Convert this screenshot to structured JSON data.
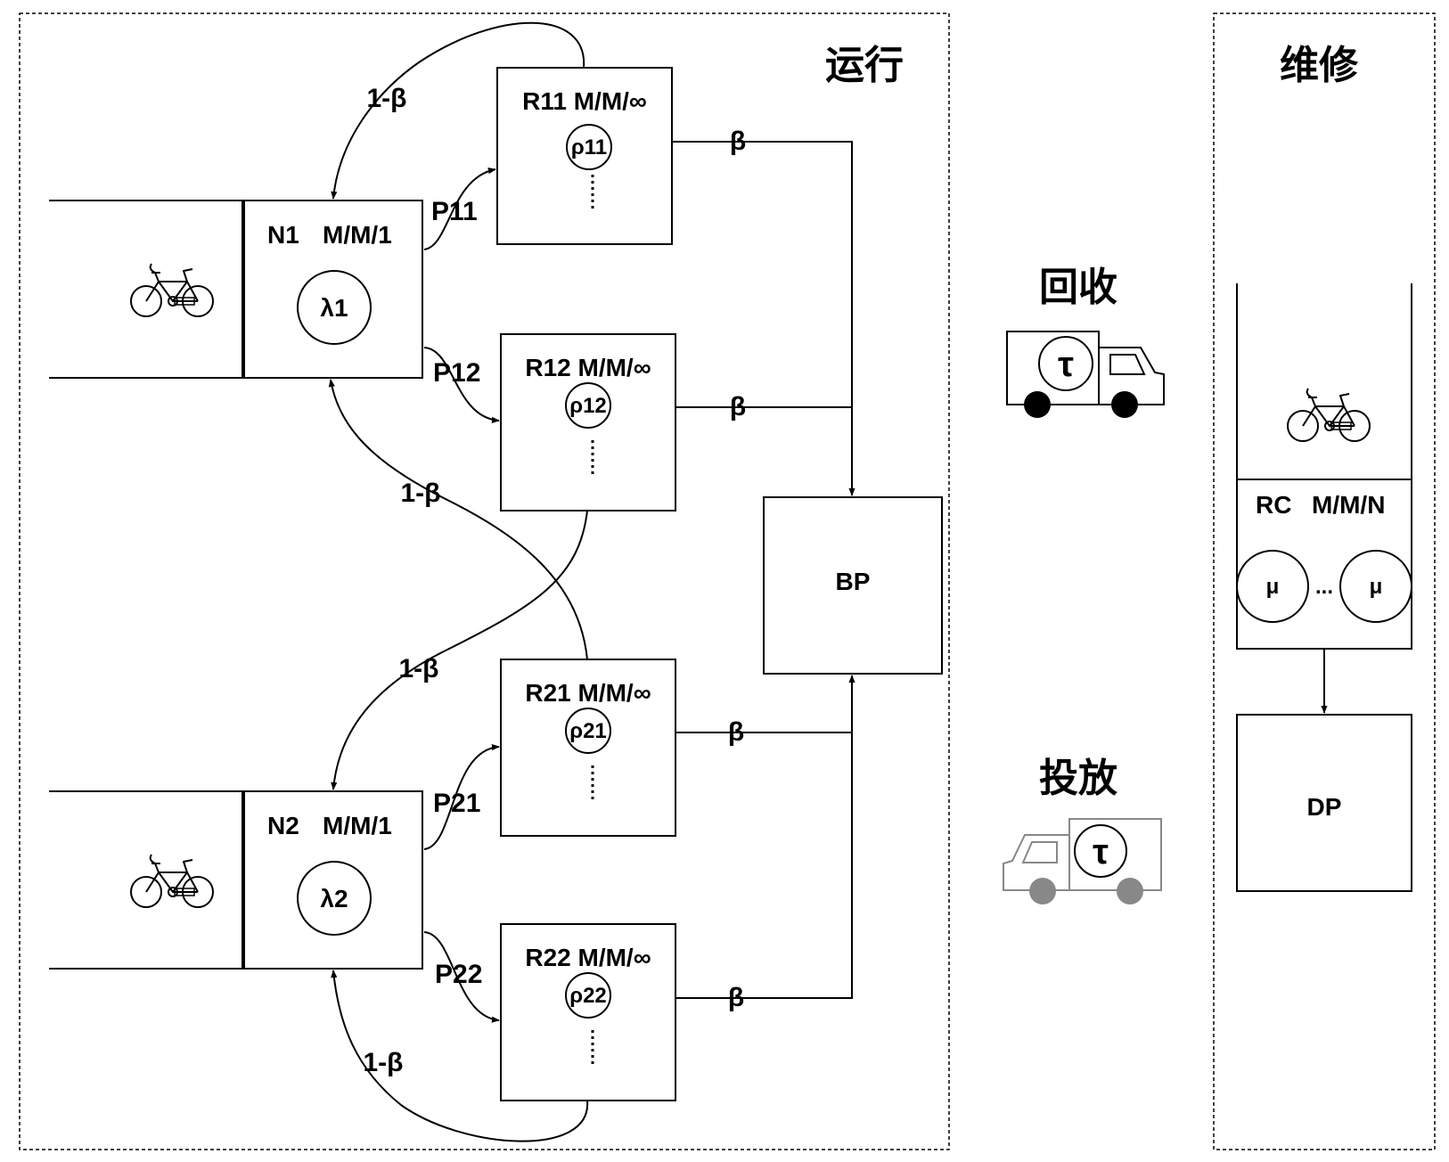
{
  "sections": {
    "operation": "运行",
    "maintenance": "维修",
    "recycle": "回收",
    "deploy": "投放"
  },
  "n1": {
    "label": "N1",
    "model": "M/M/1",
    "rate": "λ1"
  },
  "n2": {
    "label": "N2",
    "model": "M/M/1",
    "rate": "λ2"
  },
  "r11": {
    "label": "R11 M/M/∞",
    "rate": "ρ11"
  },
  "r12": {
    "label": "R12 M/M/∞",
    "rate": "ρ12"
  },
  "r21": {
    "label": "R21 M/M/∞",
    "rate": "ρ21"
  },
  "r22": {
    "label": "R22 M/M/∞",
    "rate": "ρ22"
  },
  "edges": {
    "p11": "P11",
    "p12": "P12",
    "p21": "P21",
    "p22": "P22",
    "beta": "β",
    "one_minus_beta": "1-β"
  },
  "bp": "BP",
  "rc": {
    "label": "RC",
    "model": "M/M/N",
    "server_rate": "μ",
    "ellipsis": "..."
  },
  "dp": "DP",
  "truck": {
    "time": "τ"
  }
}
